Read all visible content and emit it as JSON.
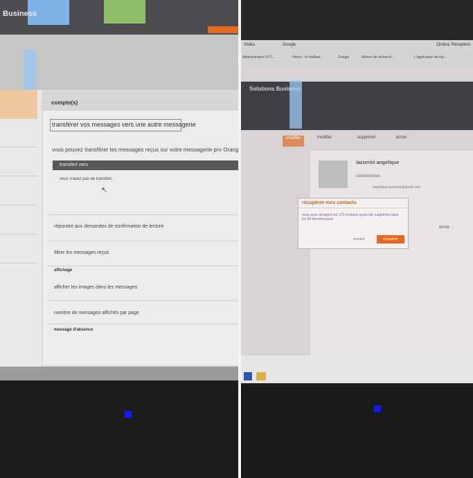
{
  "left_photo": {
    "brand": "Business",
    "panel_title": "compte(s)",
    "forward_heading": "transférer vos messages vers une autre messagerie",
    "forward_desc": "vous pouvez transférer les messages reçus sur votre messagerie pro Orange",
    "transfer_bar_label": "transfert vers",
    "no_transfer_text": "vous n'avez pas de transfert.",
    "read_receipt": "répondre aux demandes de confirmation de lecture",
    "filter_messages": "filtrer les messages reçus",
    "display_section": "affichage",
    "show_images": "afficher les images dans les messages",
    "messages_per_page": "nombre de messages affichés par page",
    "absence_section": "message d'absence"
  },
  "right_photo": {
    "tabs": [
      "Slides",
      "Google",
      "Zimbra: Réception"
    ],
    "bookmarks": [
      "Administration SI P...",
      "Heron - le meilleur...",
      "Google",
      "Moteur de recherch...",
      "L'application de bur..."
    ],
    "brand": "Solutions Business",
    "toolbar": [
      "modifier",
      "supprimer",
      "écrire"
    ],
    "contact_name": "lazzerini angelique",
    "coordinates_label": "coordonnées",
    "email": "angelique.lazzerini@gmail.com",
    "write_button": "écrire",
    "modal": {
      "title": "récupérer mes contacts",
      "text": "vous avez récupéré les 173 contacts ayant été supprimés dans les 60 derniers jours",
      "cancel": "annuler",
      "confirm": "récupérer"
    }
  },
  "colors": {
    "accent": "#e9671b",
    "led": "#1616ff"
  }
}
